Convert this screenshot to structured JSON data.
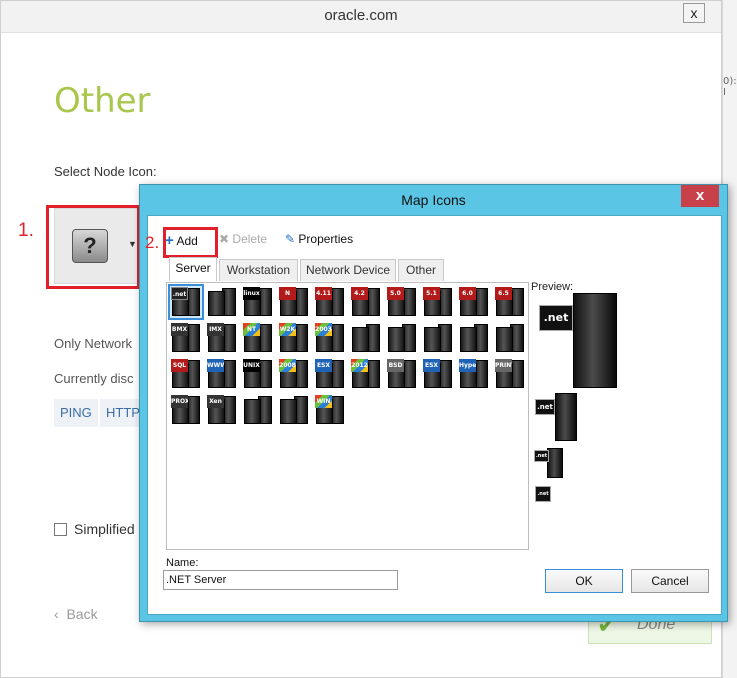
{
  "outer": {
    "title": "oracle.com",
    "close": "x",
    "page_title": "Other",
    "select_node_label": "Select Node Icon:",
    "step1": "1.",
    "only_network": "Only Network",
    "currently_disc": "Currently disc",
    "protocols": [
      "PING",
      "HTTP"
    ],
    "simplified_label": "Simplified",
    "back_label": "Back",
    "done_label": "Done",
    "bg_fragments": [
      "0): I",
      "): I"
    ]
  },
  "map_icons": {
    "title": "Map Icons",
    "close": "x",
    "step2": "2.",
    "toolbar": {
      "add": "Add",
      "delete": "Delete",
      "properties": "Properties"
    },
    "tabs": [
      {
        "label": "Server",
        "active": true
      },
      {
        "label": "Workstation",
        "active": false
      },
      {
        "label": "Network Device",
        "active": false
      },
      {
        "label": "Other",
        "active": false
      }
    ],
    "icons": [
      [
        ".net",
        "",
        "linux",
        "N",
        "4.11",
        "4.2",
        "5.0",
        "5.1",
        "6.0",
        "6.5"
      ],
      [
        "BMX",
        "IMX",
        "NT",
        "W2K",
        "2003",
        "",
        "",
        "",
        "",
        ""
      ],
      [
        "SQL",
        "WWW",
        "UNIX",
        "2008",
        "ESX",
        "2012",
        "BSD",
        "ESX",
        "HyperV",
        "PRINT SERVER"
      ],
      [
        "PROXY",
        "Xen",
        "",
        "",
        "WIN"
      ]
    ],
    "preview_label": "Preview:",
    "preview_badge": ".net",
    "name_label": "Name:",
    "name_value": ".NET Server",
    "ok_label": "OK",
    "cancel_label": "Cancel"
  }
}
